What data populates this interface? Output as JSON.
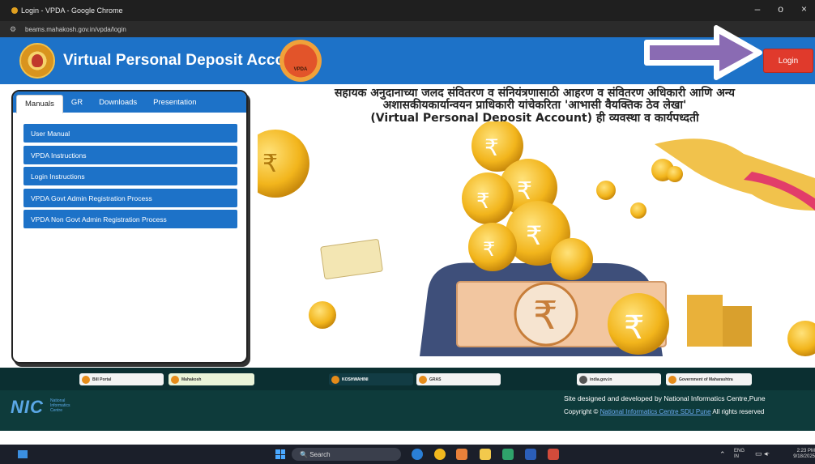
{
  "browser": {
    "window_title": "Login - VPDA - Google Chrome",
    "url": "beams.mahakosh.gov.in/vpda/login",
    "window_controls": [
      "–",
      "o",
      "×"
    ]
  },
  "header": {
    "title": "Virtual Personal Deposit Account",
    "right_logo_text": "VPDA",
    "login_label": "Login",
    "header_color": "#1d72c8",
    "login_color": "#e03a2c",
    "annotation_arrow_color": "#8a6bb3"
  },
  "panel": {
    "tabs": [
      {
        "label": "Manuals"
      },
      {
        "label": "GR"
      },
      {
        "label": "Downloads"
      },
      {
        "label": "Presentation"
      }
    ],
    "items": [
      {
        "label": "User Manual"
      },
      {
        "label": "VPDA Instructions"
      },
      {
        "label": "Login Instructions"
      },
      {
        "label": "VPDA Govt Admin Registration Process"
      },
      {
        "label": "VPDA Non Govt Admin Registration Process"
      }
    ]
  },
  "hero": {
    "line1": "सहायक अनुदानाच्या जलद संवितरण व संनियंत्रणासाठी आहरण व संवितरण अधिकारी आणि अन्य",
    "line2": "अशासकीयकार्यान्वयन प्राधिकारी यांचेकरिता 'आभासी वैयक्तिक ठेव लेखा'",
    "line3": "(Virtual Personal Deposit Account) ही व्यवस्था व कार्यपध्दती"
  },
  "footer": {
    "logos": [
      {
        "name": "Bill Portal"
      },
      {
        "name": "Mahakosh"
      },
      {
        "name": "KOSHWAHINI"
      },
      {
        "name": "GRAS"
      },
      {
        "name": "india.gov.in"
      },
      {
        "name": "Government of Maharashtra"
      }
    ],
    "nic": "NIC",
    "nic_sub1": "National",
    "nic_sub2": "Informatics",
    "nic_sub3": "Centre",
    "credit": "Site designed and developed by National Informatics Centre,Pune",
    "copyright_prefix": "Copyright ©",
    "copyright_link": "National Informatics Centre SDU Pune",
    "copyright_suffix": "All rights reserved"
  },
  "taskbar": {
    "search_label": "Search",
    "lang_line1": "ENG",
    "lang_line2": "IN",
    "time": "2:23 PM",
    "date": "9/18/2025"
  }
}
